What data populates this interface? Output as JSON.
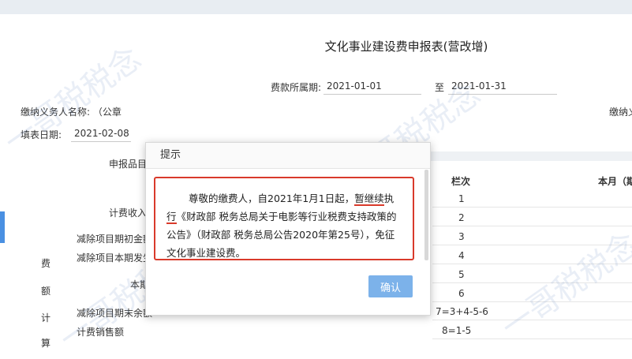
{
  "form": {
    "title": "文化事业建设费申报表(营改增)",
    "period_label": "费款所属期:",
    "period_start": "2021-01-01",
    "period_to": "至",
    "period_end": "2021-01-31",
    "taxpayer_label": "缴纳义务人名称: （公章",
    "taxpayer_right": "缴纳义",
    "fill_date_label": "填表日期:",
    "fill_date": "2021-02-08",
    "item_header": "申报品目",
    "col_seq": "栏次",
    "col_month": "本月（期"
  },
  "rows": [
    {
      "label": "计费收入",
      "seq": "1"
    },
    {
      "label": "",
      "seq": "2"
    },
    {
      "label": "减除项目期初金额",
      "seq": "3"
    },
    {
      "label": "减除项目本期发生",
      "seq": "4"
    },
    {
      "label": "本期",
      "seq": "5"
    },
    {
      "label": "",
      "seq": "6"
    },
    {
      "label": "减除项目期末余额",
      "seq": "7=3+4-5-6"
    },
    {
      "label": "计费销售额",
      "seq": "8=1-5"
    }
  ],
  "vertical_labels": [
    "费",
    "额",
    "计",
    "算"
  ],
  "watermark": "一哥税税念",
  "modal": {
    "title": "提示",
    "msg_part1": "尊敬的缴费人，自2021年1月1日起，",
    "msg_emph1": "暂继续",
    "msg_part2": "执",
    "msg_emph2": "行",
    "msg_part3": "《财政部 税务总局关于电影等行业税费支持政策的公告》（财政部 税务总局公告2020年第25号），免征文化事业建设费。",
    "ok_label": "确认"
  }
}
